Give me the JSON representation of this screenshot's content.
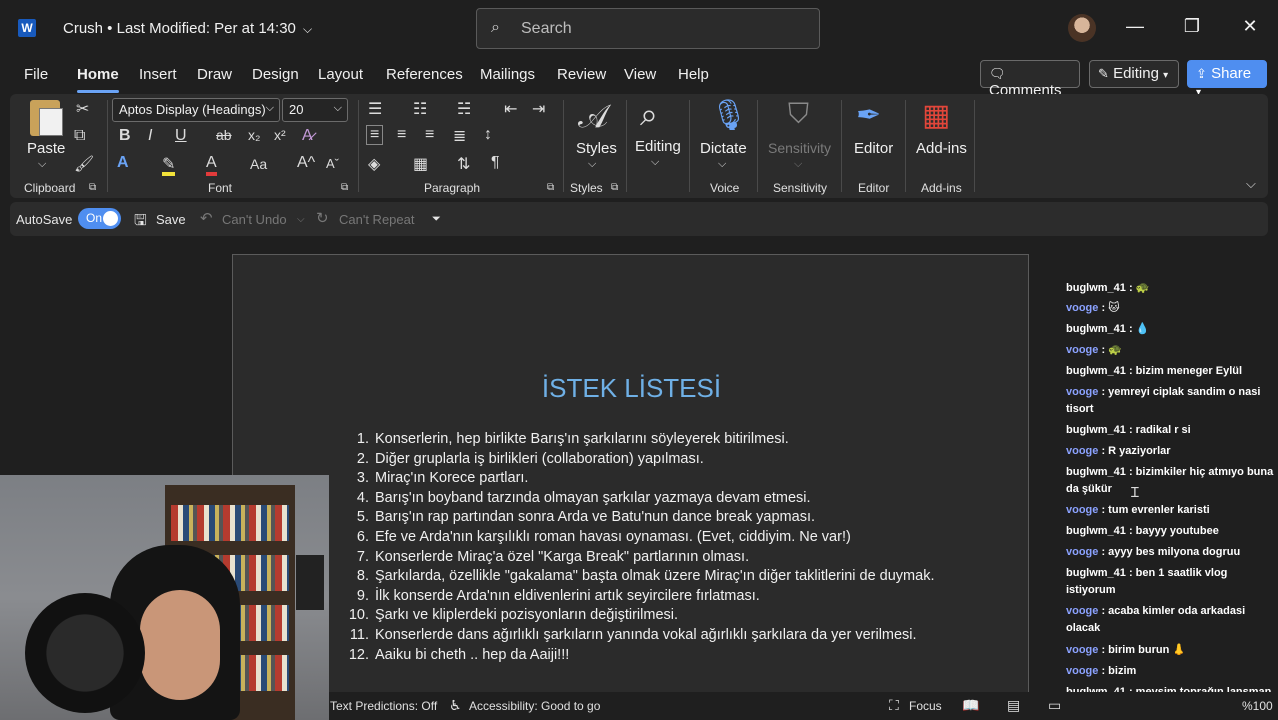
{
  "titlebar": {
    "app_logo": "W",
    "doc_title": "Crush • Last Modified: Per at 14:30",
    "search_placeholder": "Search",
    "icons": [
      "word-icon",
      "chevron-down-icon",
      "search-icon",
      "avatar",
      "minimize-icon",
      "restore-icon",
      "close-icon"
    ]
  },
  "tabs": [
    "File",
    "Home",
    "Insert",
    "Draw",
    "Design",
    "Layout",
    "References",
    "Mailings",
    "Review",
    "View",
    "Help"
  ],
  "active_tab": "Home",
  "top_buttons": {
    "comments": "Comments",
    "editing": "Editing",
    "share": "Share"
  },
  "ribbon": {
    "paste": "Paste",
    "clipboard": "Clipboard",
    "font_name": "Aptos Display (Headings)",
    "font_size": "20",
    "font": "Font",
    "paragraph": "Paragraph",
    "styles_btn": "Styles",
    "styles_group": "Styles",
    "editing_btn": "Editing",
    "dictate": "Dictate",
    "voice": "Voice",
    "sensitivity_btn": "Sensitivity",
    "sensitivity_group": "Sensitivity",
    "editor_btn": "Editor",
    "editor_group": "Editor",
    "addins_btn": "Add-ins",
    "addins_group": "Add-ins",
    "format_glyphs": {
      "bold": "B",
      "italic": "I",
      "underline": "U",
      "strike": "ab",
      "sub": "x₂",
      "sup": "x²",
      "grow": "A^",
      "shrink": "Aˇ",
      "case": "Aa"
    }
  },
  "qat": {
    "autosave": "AutoSave",
    "toggle": "On",
    "save": "Save",
    "undo": "Can't Undo",
    "redo": "Can't Repeat"
  },
  "document": {
    "heading": "İSTEK LİSTESİ",
    "items": [
      {
        "n": "1.",
        "text": "Konserlerin, hep birlikte Barış'ın şarkılarını söyleyerek bitirilmesi."
      },
      {
        "n": "2.",
        "text": "Diğer gruplarla iş birlikleri (collaboration) yapılması."
      },
      {
        "n": "3.",
        "text": "Miraç'ın Korece partları."
      },
      {
        "n": "4.",
        "text": "Barış'ın boyband tarzında olmayan şarkılar yazmaya devam etmesi."
      },
      {
        "n": "5.",
        "text": "Barış'ın rap partından sonra Arda ve Batu'nun dance break yapması."
      },
      {
        "n": "6.",
        "text": "Efe ve Arda'nın karşılıklı roman havası oynaması. (Evet, ciddiyim. Ne var!)"
      },
      {
        "n": "7.",
        "text": "Konserlerde Miraç'a özel \"Karga Break\" partlarının olması."
      },
      {
        "n": "8.",
        "text": "Şarkılarda, özellikle \"gakalama\" başta olmak üzere Miraç'ın diğer taklitlerini de duymak."
      },
      {
        "n": "9.",
        "text": "İlk konserde Arda'nın eldivenlerini artık seyircilere fırlatması."
      },
      {
        "n": "10.",
        "text": "Şarkı ve kliplerdeki pozisyonların değiştirilmesi."
      },
      {
        "n": "11.",
        "text": "Konserlerde dans ağırlıklı şarkıların yanında vokal ağırlıklı şarkılara da yer verilmesi."
      },
      {
        "n": "12.",
        "text": "Aaiku bi cheth  ..  hep da   Aaiji!!!"
      }
    ]
  },
  "chat": [
    {
      "user": "buglwm_41",
      "text": " : 🐢"
    },
    {
      "user": "vooge",
      "text": " : 🐱"
    },
    {
      "user": "buglwm_41",
      "text": " : 💧"
    },
    {
      "user": "vooge",
      "text": " : 🐢"
    },
    {
      "user": "buglwm_41",
      "text": " : bizim meneger Eylül"
    },
    {
      "user": "vooge",
      "text": " : yemreyi ciplak sandim o nasi tisort"
    },
    {
      "user": "buglwm_41",
      "text": " : radikal r si"
    },
    {
      "user": "vooge",
      "text": " : R yaziyorlar"
    },
    {
      "user": "buglwm_41",
      "text": " : bizimkiler hiç atmıyo buna da şükür"
    },
    {
      "user": "vooge",
      "text": " : tum evrenler karisti"
    },
    {
      "user": "buglwm_41",
      "text": " : bayyy youtubee"
    },
    {
      "user": "vooge",
      "text": " : ayyy bes milyona dogruu"
    },
    {
      "user": "buglwm_41",
      "text": " : ben 1 saatlik vlog istiyorum"
    },
    {
      "user": "vooge",
      "text": " : acaba kimler oda arkadasi olacak"
    },
    {
      "user": "vooge",
      "text": " : birim burun 👃"
    },
    {
      "user": "vooge",
      "text": " : bizim"
    },
    {
      "user": "buglwm_41",
      "text": " : mevsim toprağın lansman evloguna baksana çok eğlenceli"
    }
  ],
  "status": {
    "text_predictions": "Text Predictions: Off",
    "accessibility": "Accessibility: Good to go",
    "focus": "Focus",
    "zoom": "%100"
  },
  "colors": {
    "accent": "#4f8ef0",
    "heading": "#6fb0e6",
    "vooge": "#8ba2ff",
    "background": "#1f1f1f",
    "ribbon": "#2c2c2c"
  }
}
